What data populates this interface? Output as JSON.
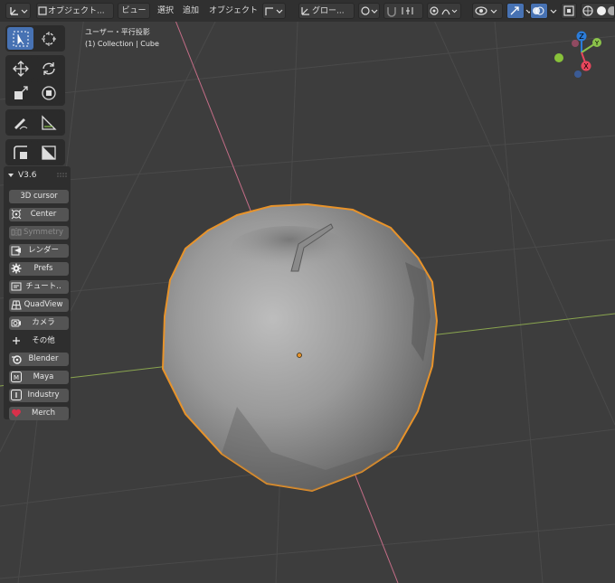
{
  "header": {
    "mode_label": "オブジェクト...",
    "menu": {
      "view": "ビュー",
      "select": "選択",
      "add": "追加",
      "object": "オブジェクト"
    },
    "orientation_label": "グロー..."
  },
  "overlay": {
    "view_name": "ユーザー・平行投影",
    "collection_info": "(1) Collection | Cube"
  },
  "toolbar": {
    "icons": [
      "select-box-icon",
      "cursor-icon",
      "move-icon",
      "rotate-icon",
      "scale-icon",
      "transform-icon",
      "annotate-icon",
      "measure-icon",
      "inset-icon",
      "bevel-icon"
    ]
  },
  "panel": {
    "title": "V3.6",
    "buttons": [
      {
        "label": "3D cursor",
        "icon": "none"
      },
      {
        "label": "Center",
        "icon": "center-icon"
      },
      {
        "label": "Symmetry",
        "icon": "symmetry-icon",
        "disabled": true
      },
      {
        "label": "レンダー",
        "icon": "render-icon"
      },
      {
        "label": "Prefs",
        "icon": "gear-icon"
      },
      {
        "label": "チュート..",
        "icon": "tutorial-icon"
      },
      {
        "label": "QuadView",
        "icon": "quadview-icon"
      },
      {
        "label": "カメラ",
        "icon": "camera-icon"
      },
      {
        "label": "その他",
        "icon": "plus-icon",
        "plain": true
      },
      {
        "label": "Blender",
        "icon": "blender-icon"
      },
      {
        "label": "Maya",
        "icon": "maya-icon"
      },
      {
        "label": "Industry",
        "icon": "industry-icon"
      },
      {
        "label": "Merch",
        "icon": "heart-icon"
      }
    ]
  },
  "gizmo": {
    "z": "Z",
    "y": "Y",
    "x": "X"
  },
  "colors": {
    "viewport_bg": "#3d3d3d",
    "selection_outline": "#e8932a",
    "active_tool": "#4772b3",
    "x_axis": "#e8465c",
    "y_axis": "#8bc34a",
    "z_axis": "#2b7cd9"
  }
}
